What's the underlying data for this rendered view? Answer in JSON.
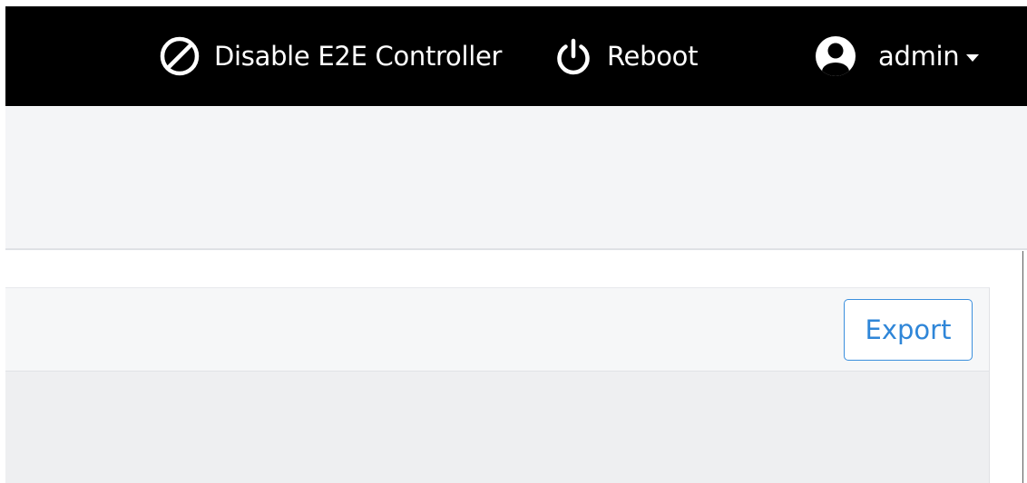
{
  "topbar": {
    "disable_controller": {
      "label": "Disable E2E Controller",
      "icon": "ban-icon"
    },
    "reboot": {
      "label": "Reboot",
      "icon": "power-icon"
    },
    "user_menu": {
      "label": "admin",
      "icon": "user-circle-icon",
      "dropdown_icon": "caret-down-icon"
    }
  },
  "panel": {
    "export_label": "Export"
  },
  "colors": {
    "topbar_bg": "#000000",
    "header_bg": "#f4f5f7",
    "accent": "#2f86d8"
  }
}
